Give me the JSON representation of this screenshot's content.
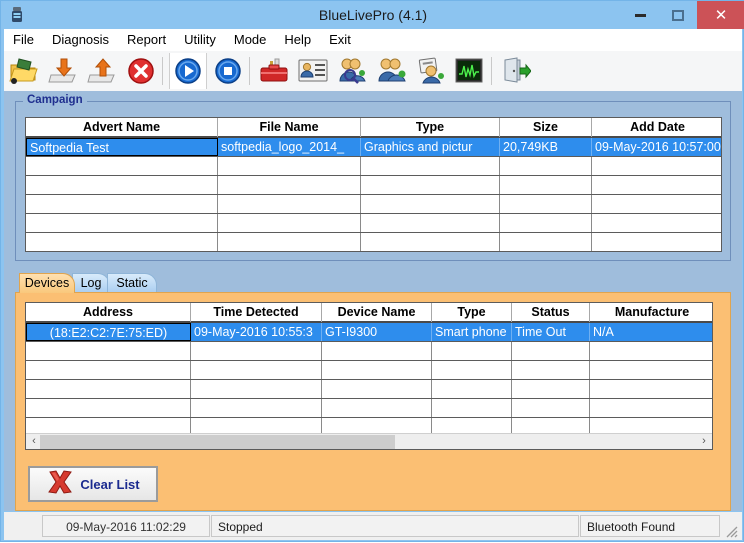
{
  "window": {
    "title": "BlueLivePro (4.1)",
    "icon": "app-icon",
    "minimize_label": "minimize",
    "maximize_label": "maximize",
    "close_label": "✕",
    "accent_titlebar": "#8cc4f0",
    "accent_close": "#cc5257"
  },
  "menu": {
    "items": [
      {
        "label": "File"
      },
      {
        "label": "Diagnosis"
      },
      {
        "label": "Report"
      },
      {
        "label": "Utility"
      },
      {
        "label": "Mode"
      },
      {
        "label": "Help"
      },
      {
        "label": "Exit"
      }
    ]
  },
  "toolbar": {
    "buttons": [
      {
        "name": "open-folder-icon",
        "tooltip": "Open"
      },
      {
        "name": "import-icon",
        "tooltip": "Import"
      },
      {
        "name": "export-icon",
        "tooltip": "Export"
      },
      {
        "name": "delete-icon",
        "tooltip": "Delete"
      },
      {
        "name": "start-icon",
        "tooltip": "Start"
      },
      {
        "name": "stop-icon",
        "tooltip": "Stop"
      },
      {
        "name": "toolbox-icon",
        "tooltip": "Tools"
      },
      {
        "name": "contact-card-icon",
        "tooltip": "Contacts"
      },
      {
        "name": "find-users-icon",
        "tooltip": "Find Users"
      },
      {
        "name": "users-icon",
        "tooltip": "Users"
      },
      {
        "name": "user-report-icon",
        "tooltip": "User Report"
      },
      {
        "name": "signal-monitor-icon",
        "tooltip": "Monitor"
      },
      {
        "name": "exit-door-icon",
        "tooltip": "Exit"
      }
    ]
  },
  "campaign": {
    "group_label": "Campaign",
    "columns": [
      "Advert Name",
      "File Name",
      "Type",
      "Size",
      "Add Date"
    ],
    "rows": [
      {
        "selected": true,
        "cells": [
          "Softpedia Test",
          "softpedia_logo_2014_",
          "Graphics and pictur",
          "20,749KB",
          "09-May-2016 10:57:00"
        ]
      }
    ],
    "empty_row_count": 5
  },
  "tabs": {
    "items": [
      {
        "label": "Devices",
        "active": true
      },
      {
        "label": "Log",
        "active": false
      },
      {
        "label": "Static",
        "active": false
      }
    ]
  },
  "devices": {
    "columns": [
      "Address",
      "Time Detected",
      "Device Name",
      "Type",
      "Status",
      "Manufacture"
    ],
    "rows": [
      {
        "selected": true,
        "cells": [
          "(18:E2:C2:7E:75:ED)",
          "09-May-2016 10:55:3",
          "GT-I9300",
          "Smart phone",
          "Time Out",
          "N/A"
        ]
      }
    ],
    "empty_row_count": 5,
    "scroll": {
      "left_arrow": "‹",
      "right_arrow": "›"
    },
    "clear_button": {
      "label": "Clear List",
      "icon": "red-x-icon"
    }
  },
  "statusbar": {
    "timestamp": "09-May-2016 11:02:29",
    "state": "Stopped",
    "bluetooth": "Bluetooth Found"
  }
}
